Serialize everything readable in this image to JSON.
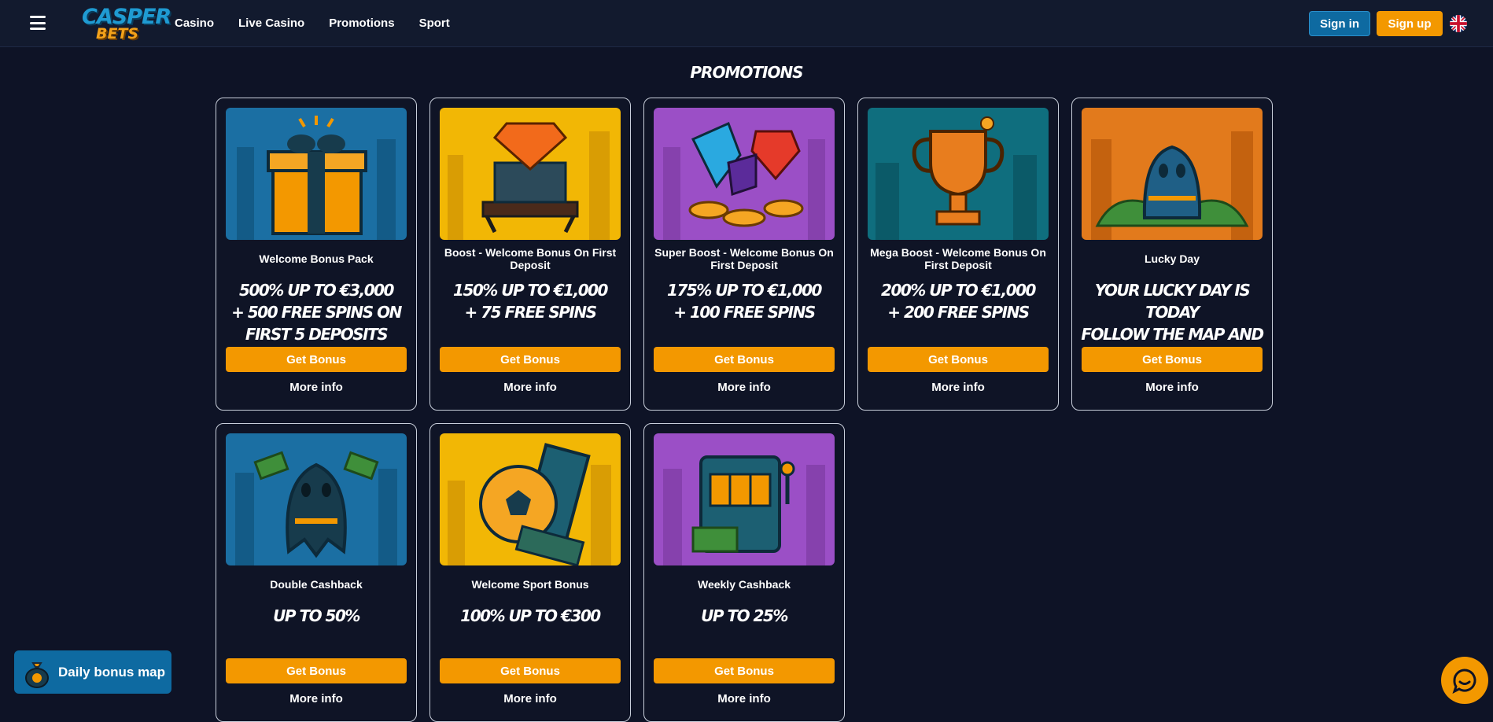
{
  "header": {
    "menu_icon": "hamburger-menu-icon",
    "logo_line1": "CASPER",
    "logo_line2": "BETS",
    "nav": [
      {
        "label": "Casino"
      },
      {
        "label": "Live Casino"
      },
      {
        "label": "Promotions"
      },
      {
        "label": "Sport"
      }
    ],
    "signin_label": "Sign in",
    "signup_label": "Sign up",
    "language_icon": "uk-flag-icon"
  },
  "page_title": "PROMOTIONS",
  "promotions": [
    {
      "title": "Welcome Bonus Pack",
      "promo_lines": [
        "500% up to €3,000",
        "+ 500 free spins on first 5 deposits"
      ],
      "cta": "Get Bonus",
      "more": "More info",
      "image": "gift-box-icon",
      "bg": "#1b6fa3"
    },
    {
      "title": "Boost - Welcome Bonus On First Deposit",
      "promo_lines": [
        "150% up to €1,000",
        "+ 75 free spins"
      ],
      "cta": "Get Bonus",
      "more": "More info",
      "image": "diamond-on-cash-icon",
      "bg": "#f2b705"
    },
    {
      "title": "Super Boost - Welcome Bonus On First Deposit",
      "promo_lines": [
        "175% up to €1,000",
        "+ 100 free spins"
      ],
      "cta": "Get Bonus",
      "more": "More info",
      "image": "gems-and-coins-icon",
      "bg": "#9b4fc6"
    },
    {
      "title": "Mega Boost - Welcome Bonus On First Deposit",
      "promo_lines": [
        "200% up to €1,000",
        "+ 200 free spins"
      ],
      "cta": "Get Bonus",
      "more": "More info",
      "image": "trophy-icon",
      "bg": "#0f6e7e"
    },
    {
      "title": "Lucky Day",
      "promo_lines": [
        "Your lucky day is today",
        "follow the map and take your chance"
      ],
      "cta": "Get Bonus",
      "more": "More info",
      "image": "ghost-on-money-icon",
      "bg": "#e27a1c"
    },
    {
      "title": "Double Cashback",
      "promo_lines": [
        "Up to 50%"
      ],
      "cta": "Get Bonus",
      "more": "More info",
      "image": "ghost-with-cash-icon",
      "bg": "#1b6fa3"
    },
    {
      "title": "Welcome Sport Bonus",
      "promo_lines": [
        "100% up to €300"
      ],
      "cta": "Get Bonus",
      "more": "More info",
      "image": "football-and-ticket-icon",
      "bg": "#f2b705"
    },
    {
      "title": "Weekly Cashback",
      "promo_lines": [
        "Up to 25%"
      ],
      "cta": "Get Bonus",
      "more": "More info",
      "image": "slot-machine-icon",
      "bg": "#9b4fc6"
    }
  ],
  "daily_bonus": {
    "label": "Daily bonus map",
    "icon": "money-bag-icon"
  },
  "chat": {
    "icon": "chat-bubble-icon"
  },
  "colors": {
    "accent": "#f39800",
    "primary_blue": "#0e6aa1",
    "background": "#0e1326"
  }
}
